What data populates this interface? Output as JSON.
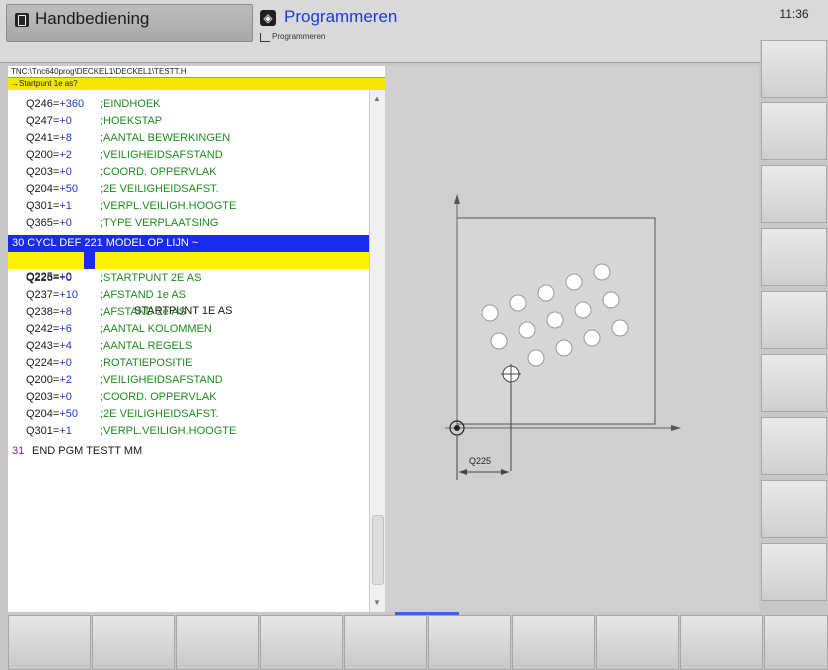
{
  "header": {
    "mode_left_label": "Handbediening",
    "mode_right_label": "Programmeren",
    "mode_right_sub": "Programmeren",
    "clock": "11:36"
  },
  "program": {
    "path": "TNC:\\Tnc640prog\\DECKEL1\\DECKEL1\\TESTT.H",
    "prompt": "→Startpunt 1e as?",
    "lines_top": [
      {
        "q": "Q246=",
        "v": "+360",
        "c": ";EINDHOEK"
      },
      {
        "q": "Q247=",
        "v": "+0",
        "c": ";HOEKSTAP"
      },
      {
        "q": "Q241=",
        "v": "+8",
        "c": ";AANTAL BEWERKINGEN"
      },
      {
        "q": "Q200=",
        "v": "+2",
        "c": ";VEILIGHEIDSAFSTAND"
      },
      {
        "q": "Q203=",
        "v": "+0",
        "c": ";COORD. OPPERVLAK"
      },
      {
        "q": "Q204=",
        "v": "+50",
        "c": ";2E VEILIGHEIDSAFST."
      },
      {
        "q": "Q301=",
        "v": "+1",
        "c": ";VERPL.VEILIGH.HOOGTE"
      },
      {
        "q": "Q365=",
        "v": "+0",
        "c": ";TYPE VERPLAATSING"
      }
    ],
    "block_line": "30 CYCL DEF 221 MODEL OP LIJN ~",
    "active_line": {
      "q": "Q225=",
      "v": "+0",
      "c": "STARTPUNT 1E AS"
    },
    "lines_bottom": [
      {
        "q": "Q226=",
        "v": "+0",
        "c": ";STARTPUNT 2E AS"
      },
      {
        "q": "Q237=",
        "v": "+10",
        "c": ";AFSTAND 1e AS"
      },
      {
        "q": "Q238=",
        "v": "+8",
        "c": ";AFSTAND 2e AS"
      },
      {
        "q": "Q242=",
        "v": "+6",
        "c": ";AANTAL KOLOMMEN"
      },
      {
        "q": "Q243=",
        "v": "+4",
        "c": ";AANTAL REGELS"
      },
      {
        "q": "Q224=",
        "v": "+0",
        "c": ";ROTATIEPOSITIE"
      },
      {
        "q": "Q200=",
        "v": "+2",
        "c": ";VEILIGHEIDSAFSTAND"
      },
      {
        "q": "Q203=",
        "v": "+0",
        "c": ";COORD. OPPERVLAK"
      },
      {
        "q": "Q204=",
        "v": "+50",
        "c": ";2E VEILIGHEIDSAFST."
      },
      {
        "q": "Q301=",
        "v": "+1",
        "c": ";VERPL.VEILIGH.HOOGTE"
      }
    ],
    "end_line_num": "31",
    "end_line_text": "END PGM TESTT MM"
  },
  "graphic": {
    "dimension_label": "Q225"
  }
}
